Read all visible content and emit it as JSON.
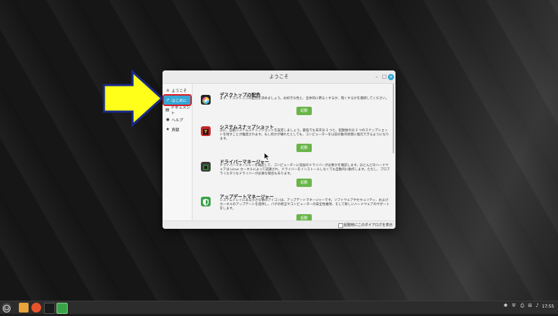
{
  "window": {
    "title": "ようこそ",
    "minimize": "–",
    "maximize": "□",
    "close": "×"
  },
  "sidebar": {
    "items": [
      {
        "label": "ようこそ",
        "icon": "home-icon"
      },
      {
        "label": "はじめに",
        "icon": "rocket-icon"
      },
      {
        "label": "ドキュメント",
        "icon": "document-icon"
      },
      {
        "label": "ヘルプ",
        "icon": "help-icon"
      },
      {
        "label": "貢献",
        "icon": "star-icon"
      }
    ]
  },
  "cards": [
    {
      "title": "デスクトップの配色",
      "desc": "まず、デスクトップの配色を決めましょう。お好きな色と、全体的に明るくするか、暗くするかを選択してください。",
      "button": "起動"
    },
    {
      "title": "システムスナップショット",
      "desc": "次に、自動システムスナップショットを設定しましょう。最低でも日次分 2 つと、起動後の分 2 つのスナップショットを残すことが推奨されます。もし何かが壊れたとしても、コンピューターを以前の動作状態に復元できるようになります。",
      "button": "起動"
    },
    {
      "title": "ドライバーマネージャー",
      "desc": "ドライバーマネージャーを確認して、コンピューターに追加のドライバーが必要かを確認します。ほとんどのハードウェアは Linux カーネルによって認識され、ドライバーをインストールしなくても自動的に動作します。ただし、プロプライエタリなドライバーが必要な場合もあります。",
      "button": "起動"
    },
    {
      "title": "アップデートマネージャー",
      "desc": "システムトレイにある小さな盾のアイコンは、アップデートマネージャーです。ソフトウェアやセキュリティ、およびカーネルのアップデートを提供し、バグの修正やコンピューターの安全性維持、そして新しいハードウェアのサポートをします。",
      "button": "起動"
    }
  ],
  "footer": {
    "show_on_startup": "起動時にこのダイアログを表示"
  },
  "taskbar": {
    "clock": "17:55"
  },
  "colors": {
    "accent": "#35a7d6",
    "launch_button": "#6ab54a",
    "arrow_fill": "#ffff1a",
    "arrow_outline": "#1a2a8c",
    "highlight_outline": "#e0181f"
  }
}
